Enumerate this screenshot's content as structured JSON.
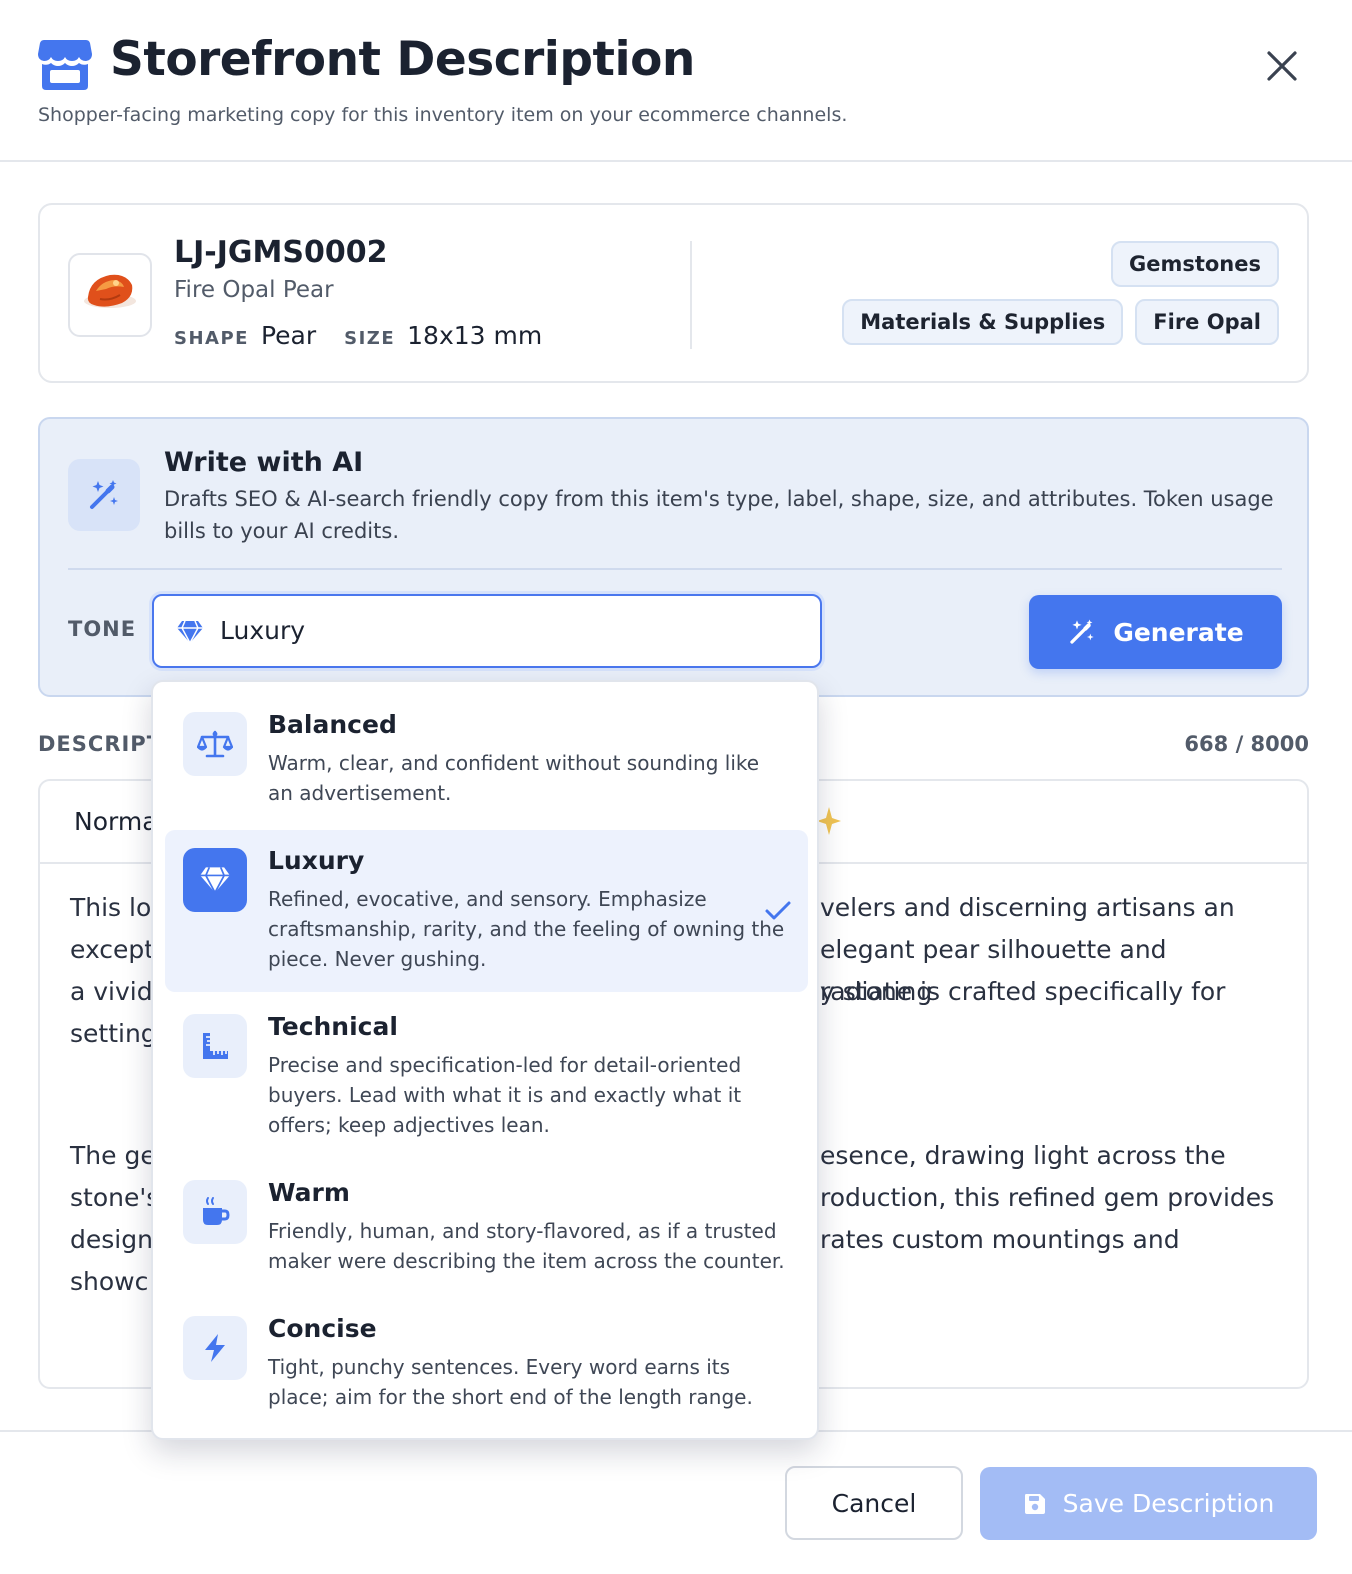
{
  "header": {
    "title": "Storefront Description",
    "subtitle": "Shopper-facing marketing copy for this inventory item on your ecommerce channels.",
    "icons": {
      "store": "storefront-icon",
      "close": "close-icon"
    }
  },
  "item": {
    "sku": "LJ-JGMS0002",
    "name": "Fire Opal Pear",
    "shape_label": "SHAPE",
    "shape_value": "Pear",
    "size_label": "SIZE",
    "size_value": "18x13 mm",
    "tags": [
      "Gemstones",
      "Materials & Supplies",
      "Fire Opal"
    ]
  },
  "ai": {
    "title": "Write with AI",
    "description": "Drafts SEO & AI-search friendly copy from this item's type, label, shape, size, and attributes. Token usage bills to your AI credits.",
    "tone_label": "TONE",
    "tone_value": "Luxury",
    "generate_label": "Generate"
  },
  "description": {
    "label": "DESCRIPT",
    "char_count": "668 / 8000",
    "format_value": "Norma",
    "paragraph_lines": [
      [
        "This lo",
        "velers and discerning artisans an"
      ],
      [
        "except",
        "elegant pear silhouette and radiating"
      ],
      [
        "a vivid",
        "y stone is crafted specifically for"
      ],
      [
        "setting",
        ""
      ]
    ],
    "paragraph2_lines": [
      [
        "The ge",
        "esence, drawing light across the"
      ],
      [
        "stone's",
        "roduction, this refined gem provides"
      ],
      [
        "design",
        "rates custom mountings and"
      ],
      [
        "showc",
        ""
      ]
    ]
  },
  "tone_options": [
    {
      "title": "Balanced",
      "description": "Warm, clear, and confident without sounding like an advertisement.",
      "icon": "balance-scale-icon",
      "selected": false
    },
    {
      "title": "Luxury",
      "description": "Refined, evocative, and sensory. Emphasize craftsmanship, rarity, and the feeling of owning the piece. Never gushing.",
      "icon": "gem-icon",
      "selected": true
    },
    {
      "title": "Technical",
      "description": "Precise and specification-led for detail-oriented buyers. Lead with what it is and exactly what it offers; keep adjectives lean.",
      "icon": "ruler-icon",
      "selected": false
    },
    {
      "title": "Warm",
      "description": "Friendly, human, and story-flavored, as if a trusted maker were describing the item across the counter.",
      "icon": "coffee-mug-icon",
      "selected": false
    },
    {
      "title": "Concise",
      "description": "Tight, punchy sentences. Every word earns its place; aim for the short end of the length range.",
      "icon": "lightning-bolt-icon",
      "selected": false
    }
  ],
  "footer": {
    "cancel_label": "Cancel",
    "save_label": "Save Description"
  },
  "colors": {
    "accent": "#4476ee",
    "accent_disabled": "#a3bcf5",
    "panel_bg": "#e9eff9",
    "sparkle": "#f1c453"
  }
}
